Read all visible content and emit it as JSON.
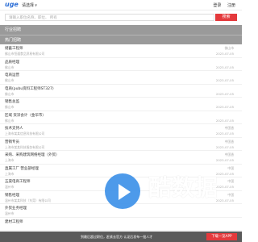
{
  "header": {
    "logo": "uge",
    "city": "请选择",
    "links": [
      "登录",
      "注册"
    ]
  },
  "search": {
    "placeholder": "请输入职位名称、职位、 所有",
    "button": "搜索"
  },
  "bars": {
    "industry": "行业招聘",
    "hot": "热门招聘"
  },
  "jobs": [
    {
      "title": "储蓄工程师",
      "company": "佛山市恒通食品贸易有限公司",
      "location": "佛山市",
      "date": "2023-07-05"
    },
    {
      "title": "品质经理",
      "company": "佛山市",
      "location": "",
      "date": "2023-07-05"
    },
    {
      "title": "电商运营",
      "company": "佛山市",
      "location": "",
      "date": "2023-07-05"
    },
    {
      "title": "电商(pubu资料工程师ST327)",
      "company": "佛山市",
      "location": "",
      "date": "2023-07-05"
    },
    {
      "title": "销售总监",
      "company": "佛山市",
      "location": "",
      "date": "2023-07-05"
    },
    {
      "title": "区域 资深会计（金华市）",
      "company": "佛山市",
      "location": "",
      "date": "2023-07-05"
    },
    {
      "title": "技术支持人",
      "company": "上海市某某信息科技有限公司",
      "location": "中国香",
      "date": "2023-07-05"
    },
    {
      "title": "营销专员",
      "company": "上海市某某科技服务有限公司",
      "location": "中国香",
      "date": "2023-07-05"
    },
    {
      "title": "采购、采购建筑网络经理（外贸）",
      "company": "上海市",
      "location": "中国香",
      "date": "2023-07-05"
    },
    {
      "title": "直属工厂 营业部经理",
      "company": "上海市",
      "location": "中国",
      "date": "2023-07-05"
    },
    {
      "title": "五渠电商工程师",
      "company": "温州市",
      "location": "中国",
      "date": "2023-07-05"
    },
    {
      "title": "销售经理",
      "company": "温州市某某科技（东莞）有限公司",
      "location": "中国",
      "date": "2023-07-05"
    },
    {
      "title": "外贸业务经理",
      "company": "温州市",
      "location": "",
      "date": ""
    },
    {
      "title": "建材工程师",
      "company": "",
      "location": "",
      "date": ""
    }
  ],
  "footer": {
    "text": "到最后超过职位，赶紧去官方 认证后发布一批人才",
    "button": "下载一览APP"
  },
  "watermark": {
    "name": "酷数据",
    "sub": "KUIDC"
  }
}
